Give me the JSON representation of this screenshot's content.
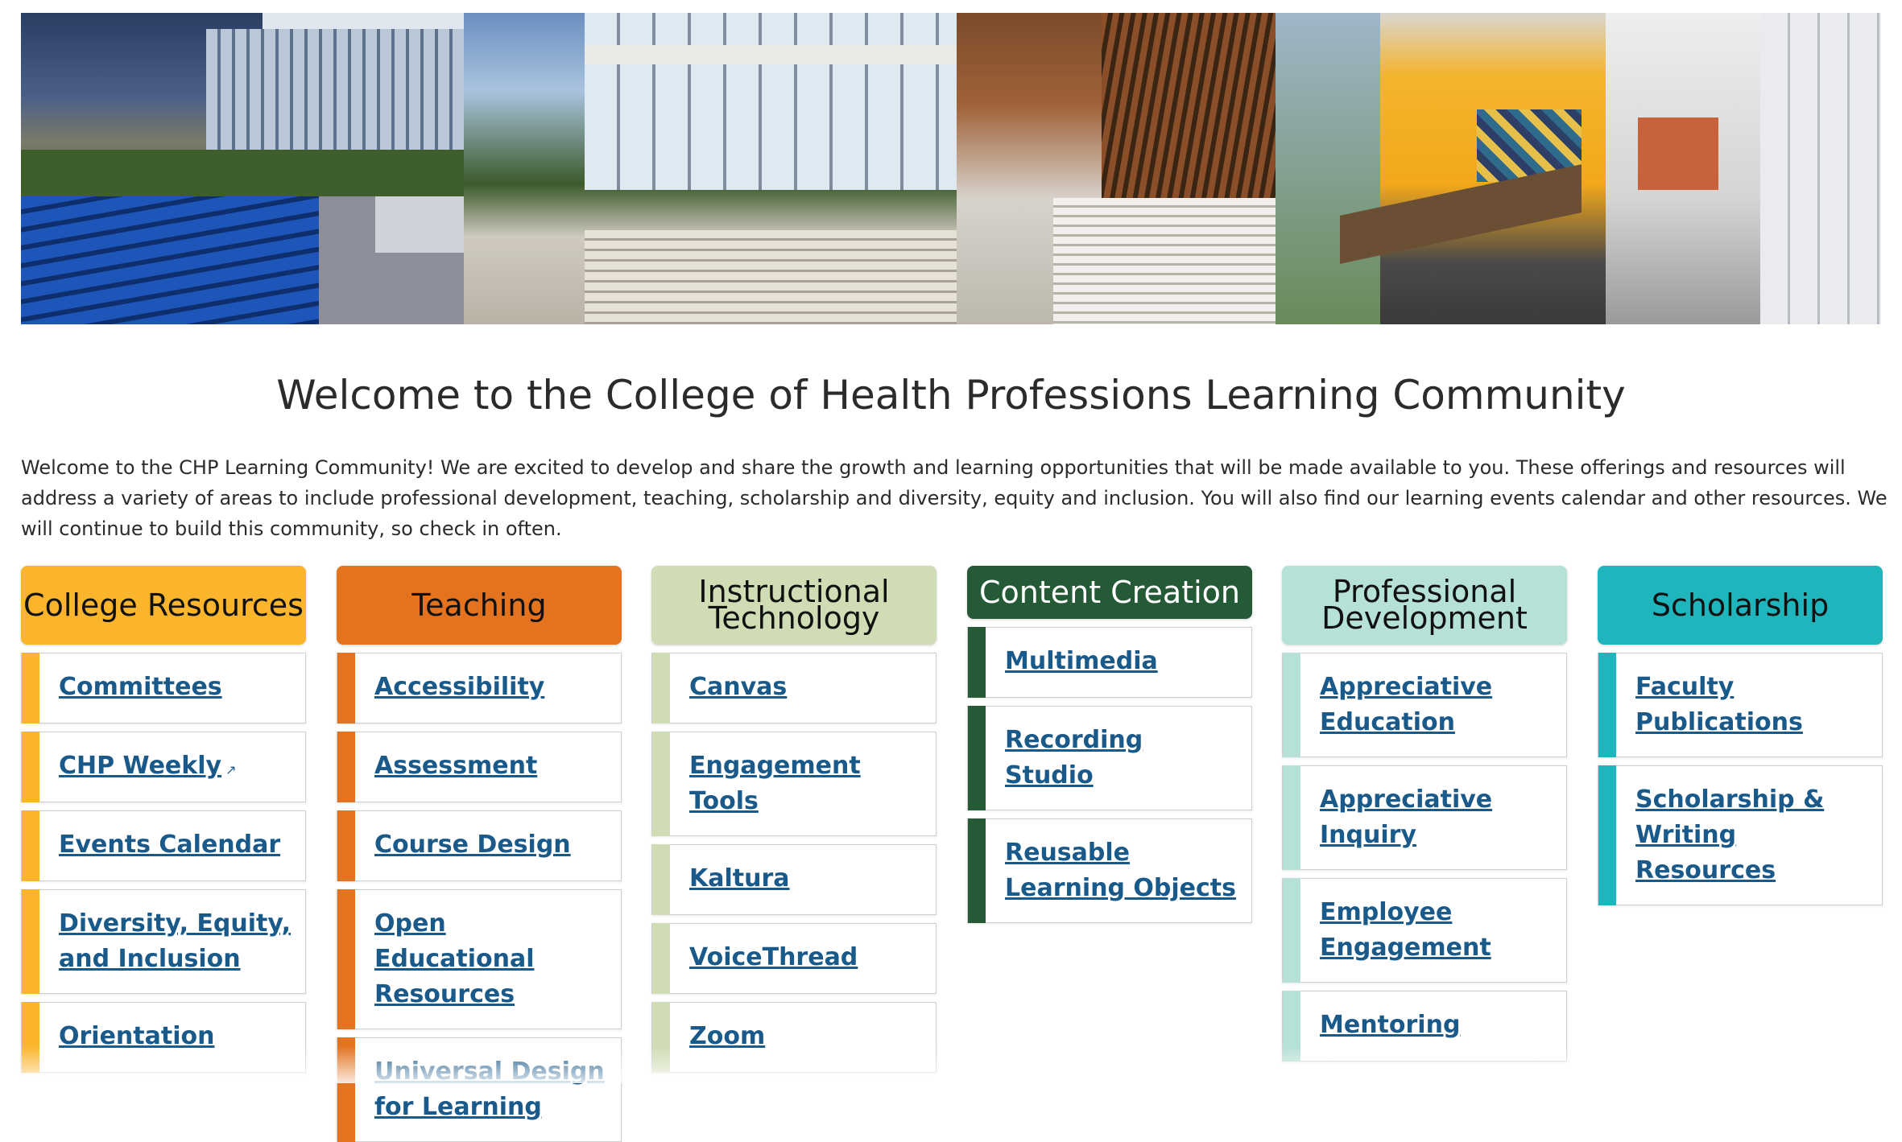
{
  "page": {
    "title": "Welcome to the College of Health Professions Learning Community",
    "intro": "Welcome to the CHP Learning Community! We are excited to develop and share the growth and learning opportunities that will be made available to you. These offerings and resources will address a variety of areas to include professional development, teaching, scholarship and diversity, equity and inclusion. You will also find our learning events calendar and other resources. We will continue to build this community, so check in often."
  },
  "columns": [
    {
      "heading": "College Resources",
      "color": "#fbb52d",
      "items": [
        {
          "label": "Committees"
        },
        {
          "label": "CHP Weekly",
          "external_icon": "external-link-icon"
        },
        {
          "label": "Events Calendar"
        },
        {
          "label": "Diversity, Equity, and Inclusion"
        },
        {
          "label": "Orientation"
        }
      ]
    },
    {
      "heading": "Teaching",
      "color": "#e3731f",
      "items": [
        {
          "label": "Accessibility"
        },
        {
          "label": "Assessment"
        },
        {
          "label": "Course Design"
        },
        {
          "label": "Open Educational Resources"
        },
        {
          "label": "Universal Design for Learning"
        }
      ]
    },
    {
      "heading": "Instructional Technology",
      "color": "#cfdcb4",
      "items": [
        {
          "label": "Canvas"
        },
        {
          "label": "Engagement Tools"
        },
        {
          "label": "Kaltura"
        },
        {
          "label": "VoiceThread"
        },
        {
          "label": "Zoom"
        }
      ]
    },
    {
      "heading": "Content Creation",
      "color": "#245a35",
      "heading_text_color": "#ffffff",
      "items": [
        {
          "label": "Multimedia"
        },
        {
          "label": "Recording Studio"
        },
        {
          "label": "Reusable Learning Objects"
        }
      ]
    },
    {
      "heading": "Professional Development",
      "color": "#b5e1d6",
      "items": [
        {
          "label": "Appreciative Education"
        },
        {
          "label": "Appreciative Inquiry"
        },
        {
          "label": "Employee Engagement"
        },
        {
          "label": "Mentoring"
        }
      ]
    },
    {
      "heading": "Scholarship",
      "color": "#1fb5bd",
      "items": [
        {
          "label": "Faculty Publications"
        },
        {
          "label": "Scholarship & Writing Resources"
        }
      ]
    }
  ],
  "colors": {
    "link": "#1a5a8a",
    "text": "#2b2b2b"
  }
}
